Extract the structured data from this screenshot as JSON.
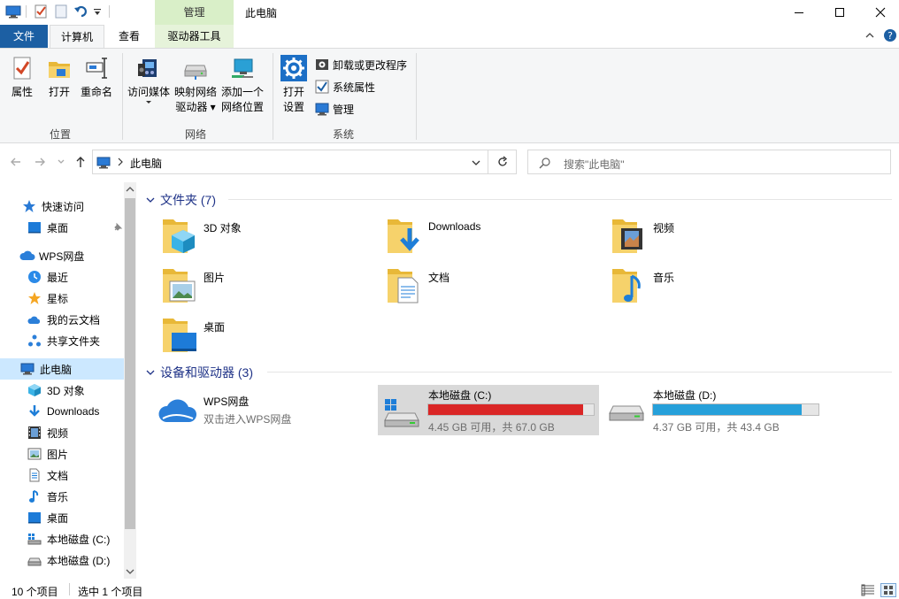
{
  "titlebar": {
    "context_tab": "管理",
    "title": "此电脑"
  },
  "tabs": {
    "file": "文件",
    "computer": "计算机",
    "view": "查看",
    "drive_tools": "驱动器工具"
  },
  "ribbon": {
    "location": {
      "label": "位置",
      "properties": "属性",
      "open": "打开",
      "rename": "重命名"
    },
    "network": {
      "label": "网络",
      "access_media": "访问媒体",
      "map_drive_line1": "映射网络",
      "map_drive_line2": "驱动器",
      "add_location_line1": "添加一个",
      "add_location_line2": "网络位置"
    },
    "system": {
      "label": "系统",
      "open_settings_line1": "打开",
      "open_settings_line2": "设置",
      "uninstall": "卸载或更改程序",
      "sys_properties": "系统属性",
      "manage": "管理"
    }
  },
  "address": {
    "path": "此电脑",
    "search_placeholder": "搜索\"此电脑\""
  },
  "nav": {
    "quick_access": "快速访问",
    "desktop_pinned": "桌面",
    "wps": "WPS网盘",
    "recent": "最近",
    "starred": "星标",
    "my_cloud_docs": "我的云文档",
    "shared_folder": "共享文件夹",
    "this_pc": "此电脑",
    "objects3d": "3D 对象",
    "downloads": "Downloads",
    "videos": "视频",
    "pictures": "图片",
    "documents": "文档",
    "music": "音乐",
    "desktop": "桌面",
    "drive_c": "本地磁盘 (C:)",
    "drive_d": "本地磁盘 (D:)"
  },
  "folders_group": {
    "title": "文件夹 (7)",
    "items": [
      "3D 对象",
      "Downloads",
      "视频",
      "图片",
      "文档",
      "音乐",
      "桌面"
    ]
  },
  "devices_group": {
    "title": "设备和驱动器 (3)",
    "wps": {
      "name": "WPS网盘",
      "sub": "双击进入WPS网盘"
    },
    "drive_c": {
      "name": "本地磁盘 (C:)",
      "free": "4.45 GB 可用，共 67.0 GB",
      "used_fraction": 0.934
    },
    "drive_d": {
      "name": "本地磁盘 (D:)",
      "free": "4.37 GB 可用，共 43.4 GB",
      "used_fraction": 0.899
    }
  },
  "statusbar": {
    "count": "10 个项目",
    "selected": "选中 1 个项目"
  },
  "colors": {
    "accent": "#1c5fa3",
    "drive_c_bar": "#da2626",
    "drive_d_bar": "#26a0da",
    "selection": "#cce8ff",
    "selected_tile": "#d9d9d9",
    "group_title": "#1e3287"
  }
}
